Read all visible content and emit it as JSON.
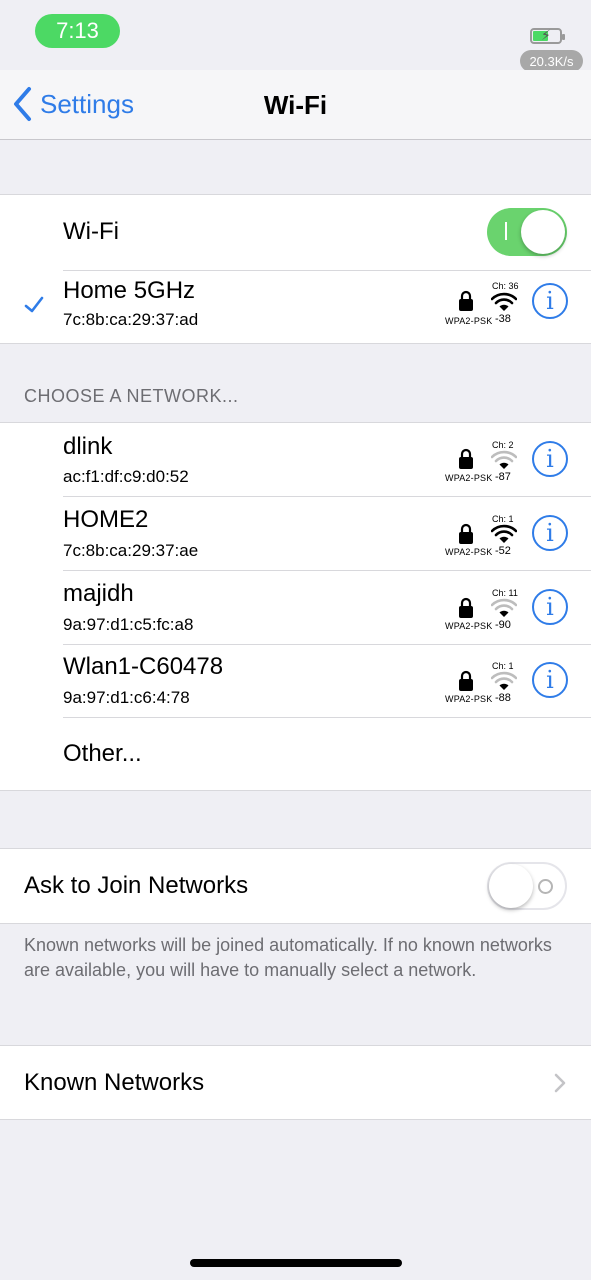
{
  "status_bar": {
    "time": "7:13",
    "network_speed": "20.3K/s",
    "icons": [
      "battery-charging-icon"
    ]
  },
  "nav": {
    "back_label": "Settings",
    "title": "Wi-Fi",
    "back_icon": "chevron-left-icon"
  },
  "wifi_toggle": {
    "label": "Wi-Fi",
    "on": true
  },
  "connected": {
    "name": "Home 5GHz",
    "mac": "7c:8b:ca:29:37:ad",
    "security": "WPA2-PSK",
    "channel": "Ch: 36",
    "rssi": "-38",
    "connected": true
  },
  "section_header": "CHOOSE A NETWORK...",
  "networks": [
    {
      "name": "dlink",
      "mac": "ac:f1:df:c9:d0:52",
      "security": "WPA2-PSK",
      "channel": "Ch: 2",
      "rssi": "-87",
      "signal": "weak"
    },
    {
      "name": "HOME2",
      "mac": "7c:8b:ca:29:37:ae",
      "security": "WPA2-PSK",
      "channel": "Ch: 1",
      "rssi": "-52",
      "signal": "strong"
    },
    {
      "name": "majidh",
      "mac": "9a:97:d1:c5:fc:a8",
      "security": "WPA2-PSK",
      "channel": "Ch: 11",
      "rssi": "-90",
      "signal": "weak"
    },
    {
      "name": "Wlan1-C60478",
      "mac": "9a:97:d1:c6:4:78",
      "security": "WPA2-PSK",
      "channel": "Ch: 1",
      "rssi": "-88",
      "signal": "weak"
    }
  ],
  "other_label": "Other...",
  "ask_to_join": {
    "label": "Ask to Join Networks",
    "on": false,
    "footer": "Known networks will be joined automatically. If no known networks are available, you will have to manually select a network."
  },
  "known_networks": {
    "label": "Known Networks"
  },
  "colors": {
    "accent": "#2f7ce8",
    "toggle_on": "#6ad36e",
    "time_pill": "#4cd964",
    "background": "#efeff4"
  }
}
